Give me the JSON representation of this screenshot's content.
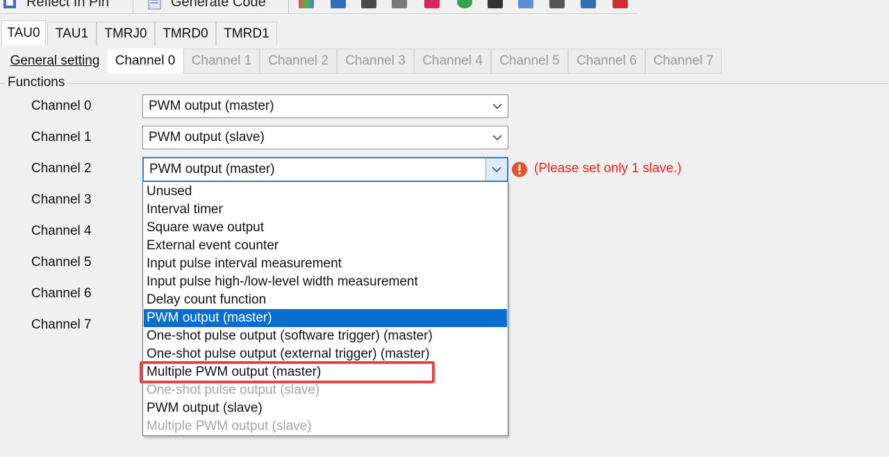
{
  "toolbar": {
    "reflect_label": "Reflect In Pin",
    "generate_label": "Generate Code"
  },
  "tabs_primary": [
    "TAU0",
    "TAU1",
    "TMRJ0",
    "TMRD0",
    "TMRD1"
  ],
  "tabs_secondary": [
    "General setting",
    "Channel 0",
    "Channel 1",
    "Channel 2",
    "Channel 3",
    "Channel 4",
    "Channel 5",
    "Channel 6",
    "Channel 7"
  ],
  "functions": {
    "group_label": "Functions",
    "channels": [
      {
        "label": "Channel 0",
        "value": "PWM output (master)"
      },
      {
        "label": "Channel 1",
        "value": "PWM output (slave)"
      },
      {
        "label": "Channel 2",
        "value": "PWM output (master)"
      },
      {
        "label": "Channel 3"
      },
      {
        "label": "Channel 4"
      },
      {
        "label": "Channel 5"
      },
      {
        "label": "Channel 6"
      },
      {
        "label": "Channel 7"
      }
    ],
    "error_message": "(Please set only 1 slave.)"
  },
  "dropdown": {
    "options": [
      {
        "label": "Unused",
        "state": "normal"
      },
      {
        "label": "Interval timer",
        "state": "normal"
      },
      {
        "label": "Square wave output",
        "state": "normal"
      },
      {
        "label": "External event counter",
        "state": "normal"
      },
      {
        "label": "Input pulse interval measurement",
        "state": "normal"
      },
      {
        "label": "Input pulse high-/low-level width measurement",
        "state": "normal"
      },
      {
        "label": "Delay count function",
        "state": "normal"
      },
      {
        "label": "PWM output (master)",
        "state": "selected"
      },
      {
        "label": "One-shot pulse output (software trigger) (master)",
        "state": "normal"
      },
      {
        "label": "One-shot pulse output (external trigger) (master)",
        "state": "normal"
      },
      {
        "label": "Multiple PWM output (master)",
        "state": "highlighted"
      },
      {
        "label": "One-shot pulse output (slave)",
        "state": "disabled"
      },
      {
        "label": "PWM output (slave)",
        "state": "normal"
      },
      {
        "label": "Multiple PWM output (slave)",
        "state": "disabled"
      }
    ]
  },
  "colors": {
    "selection": "#0a6ed1",
    "error": "#e4231b",
    "highlight_border": "#e8414a",
    "focus_border": "#2a7fd4"
  }
}
